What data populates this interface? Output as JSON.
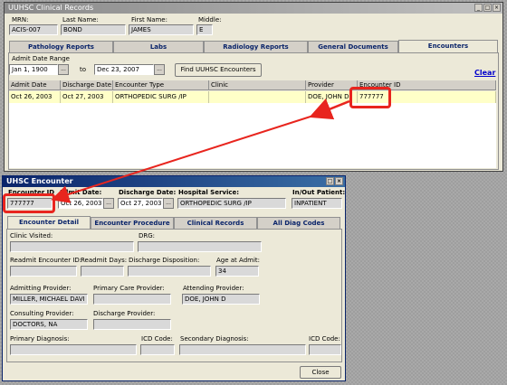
{
  "main_window": {
    "title": "UUHSC Clinical Records",
    "patient": {
      "mrn_label": "MRN:",
      "mrn": "ACIS-007",
      "last_name_label": "Last Name:",
      "last_name": "BOND",
      "first_name_label": "First Name:",
      "first_name": "JAMES",
      "middle_label": "Middle:",
      "middle": "E"
    },
    "tabs": [
      "Pathology Reports",
      "Labs",
      "Radiology Reports",
      "General Documents",
      "Encounters"
    ],
    "active_tab": "Encounters",
    "date_range_label": "Admit Date Range",
    "date_from": "Jan 1, 1900",
    "to_label": "to",
    "date_to": "Dec 23, 2007",
    "date_button": "...",
    "find_button": "Find UUHSC Encounters",
    "clear_link": "Clear",
    "table": {
      "columns": [
        "Admit Date",
        "Discharge Date",
        "Encounter Type",
        "Clinic",
        "Provider",
        "Encounter ID"
      ],
      "rows": [
        [
          "Oct 26, 2003",
          "Oct 27, 2003",
          "ORTHOPEDIC SURG /IP",
          "",
          "DOE, JOHN D",
          "777777"
        ]
      ]
    }
  },
  "detail_window": {
    "title": "UHSC Encounter",
    "encounter_id_label": "Encounter ID",
    "encounter_id": "777777",
    "admit_label": "Admit Date:",
    "admit": "Oct 26, 2003",
    "discharge_label": "Discharge Date:",
    "discharge": "Oct 27, 2003",
    "service_label": "Hospital Service:",
    "service": "ORTHOPEDIC SURG /IP",
    "inout_label": "In/Out Patient:",
    "inout": "INPATIENT",
    "date_button": "...",
    "tabs": [
      "Encounter Detail",
      "Encounter Procedure",
      "Clinical Records",
      "All Diag Codes"
    ],
    "active_tab": "Encounter Detail",
    "fields": {
      "clinic_visited_label": "Clinic Visited:",
      "clinic_visited": "",
      "drg_label": "DRG:",
      "drg": "",
      "readmit_id_label": "Readmit Encounter ID:",
      "readmit_id": "",
      "readmit_days_label": "Readmit Days:",
      "readmit_days": "",
      "discharge_disp_label": "Discharge Disposition:",
      "discharge_disp": "",
      "age_label": "Age at Admit:",
      "age": "34",
      "admitting_label": "Admitting Provider:",
      "admitting": "MILLER, MICHAEL DAVI",
      "primary_care_label": "Primary Care Provider:",
      "primary_care": "",
      "attending_label": "Attending Provider:",
      "attending": "DOE, JOHN D",
      "consulting_label": "Consulting Provider:",
      "consulting": "DOCTORS, NA",
      "discharge_prov_label": "Discharge Provider:",
      "discharge_prov": "",
      "primary_diag_label": "Primary Diagnosis:",
      "primary_diag": "",
      "icd1_label": "ICD Code:",
      "icd1": "",
      "secondary_diag_label": "Secondary Diagnosis:",
      "secondary_diag": "",
      "icd2_label": "ICD Code:",
      "icd2": ""
    },
    "close_button": "Close"
  },
  "colors": {
    "highlight": "#e8251e",
    "row": "#ffffc8",
    "tab_text": "#0a246a"
  }
}
